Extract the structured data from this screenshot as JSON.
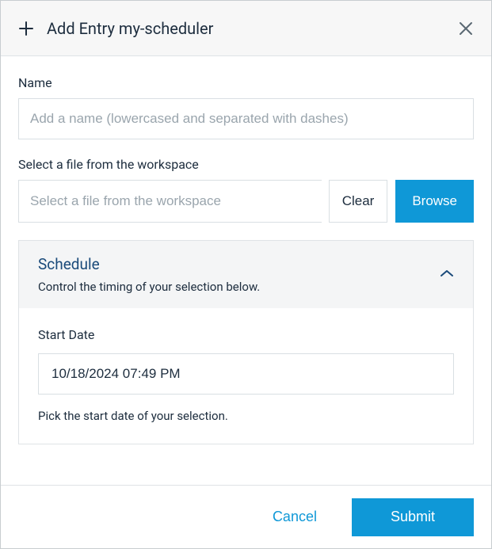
{
  "header": {
    "title": "Add Entry my-scheduler"
  },
  "name_field": {
    "label": "Name",
    "placeholder": "Add a name (lowercased and separated with dashes)",
    "value": ""
  },
  "file_field": {
    "label": "Select a file from the workspace",
    "placeholder": "Select a file from the workspace",
    "value": "",
    "clear_label": "Clear",
    "browse_label": "Browse"
  },
  "schedule_panel": {
    "title": "Schedule",
    "subtitle": "Control the timing of your selection below.",
    "expanded": true,
    "start_date": {
      "label": "Start Date",
      "value": "10/18/2024 07:49 PM",
      "help": "Pick the start date of your selection."
    }
  },
  "footer": {
    "cancel_label": "Cancel",
    "submit_label": "Submit"
  },
  "colors": {
    "primary": "#0f98d7",
    "panel_title": "#1a4a7a"
  }
}
